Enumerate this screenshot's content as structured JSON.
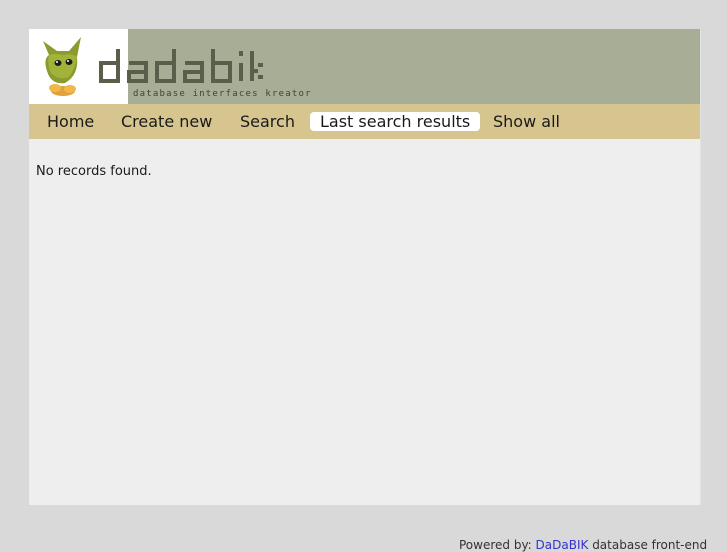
{
  "brand": {
    "wordmark": "dadabik",
    "tagline": "database interfaces kreator"
  },
  "menu": {
    "items": [
      {
        "label": "Home"
      },
      {
        "label": "Create new"
      },
      {
        "label": "Search"
      },
      {
        "label": "Last search results",
        "active": true
      },
      {
        "label": "Show all"
      }
    ]
  },
  "content": {
    "message": "No records found."
  },
  "footer": {
    "prefix": "Powered by: ",
    "link_text": "DaDaBIK",
    "suffix": " database front-end"
  },
  "colors": {
    "page_background": "#d9d9d9",
    "header_background": "#a8ae96",
    "menu_background": "#d7c58f",
    "content_background": "#eeeeee",
    "logo_green": "#8c9b2e",
    "wordmark_color": "#5a5f4c",
    "link_color": "#3333cc"
  },
  "icons": {
    "logo": "dadabik-mascot-icon"
  }
}
